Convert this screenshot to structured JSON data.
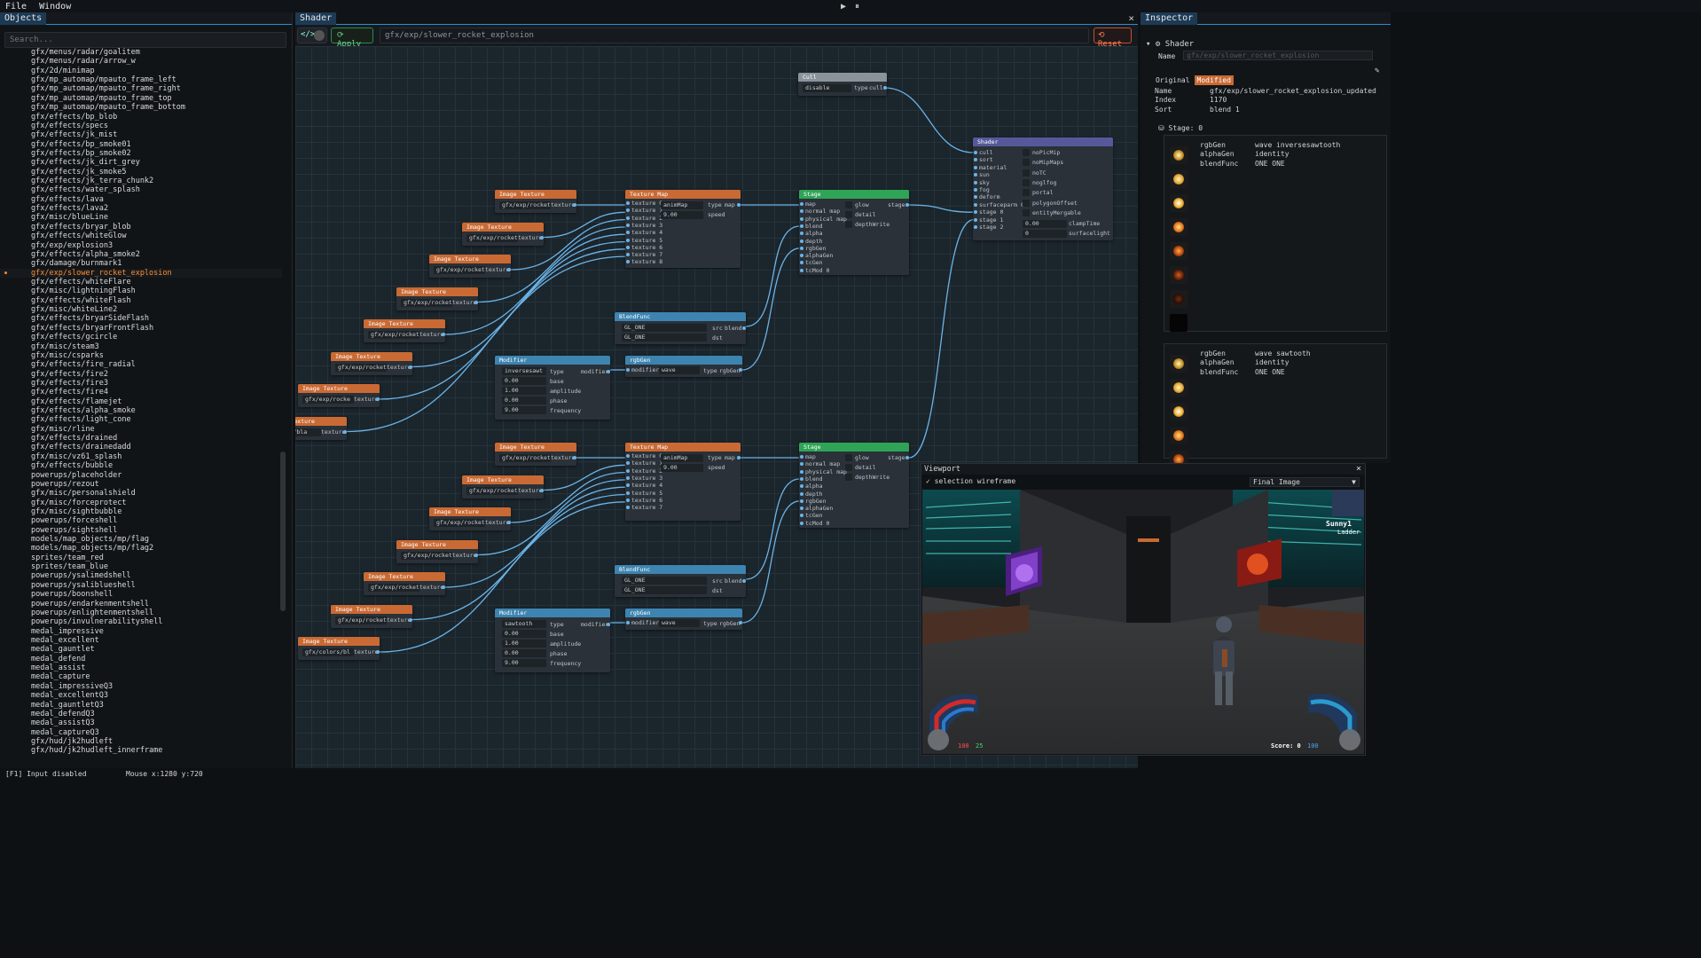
{
  "menu": {
    "file": "File",
    "window": "Window"
  },
  "playback": {
    "play": "▶",
    "pause": "⏸"
  },
  "objects": {
    "tab": "Objects",
    "search_placeholder": "Search...",
    "items": [
      "gfx/menus/radar/goalitem",
      "gfx/menus/radar/arrow_w",
      "gfx/2d/minimap",
      "gfx/mp_automap/mpauto_frame_left",
      "gfx/mp_automap/mpauto_frame_right",
      "gfx/mp_automap/mpauto_frame_top",
      "gfx/mp_automap/mpauto_frame_bottom",
      "gfx/effects/bp_blob",
      "gfx/effects/specs",
      "gfx/effects/jk_mist",
      "gfx/effects/bp_smoke01",
      "gfx/effects/bp_smoke02",
      "gfx/effects/jk_dirt_grey",
      "gfx/effects/jk_smoke5",
      "gfx/effects/jk_terra_chunk2",
      "gfx/effects/water_splash",
      "gfx/effects/lava",
      "gfx/effects/lava2",
      "gfx/misc/blueLine",
      "gfx/effects/bryar_blob",
      "gfx/effects/whiteGlow",
      "gfx/exp/explosion3",
      "gfx/effects/alpha_smoke2",
      "gfx/damage/burnmark1",
      "gfx/exp/slower_rocket_explosion",
      "gfx/effects/whiteFlare",
      "gfx/misc/lightningFlash",
      "gfx/effects/whiteFlash",
      "gfx/misc/whiteLine2",
      "gfx/effects/bryarSideFlash",
      "gfx/effects/bryarFrontFlash",
      "gfx/effects/gcircle",
      "gfx/misc/steam3",
      "gfx/misc/csparks",
      "gfx/effects/fire_radial",
      "gfx/effects/fire2",
      "gfx/effects/fire3",
      "gfx/effects/fire4",
      "gfx/effects/flamejet",
      "gfx/effects/alpha_smoke",
      "gfx/effects/light_cone",
      "gfx/misc/rline",
      "gfx/effects/drained",
      "gfx/effects/drainedadd",
      "gfx/misc/vz61_splash",
      "gfx/effects/bubble",
      "powerups/placeholder",
      "powerups/rezout",
      "gfx/misc/personalshield",
      "gfx/misc/forceprotect",
      "gfx/misc/sightbubble",
      "powerups/forceshell",
      "powerups/sightshell",
      "models/map_objects/mp/flag",
      "models/map_objects/mp/flag2",
      "sprites/team_red",
      "sprites/team_blue",
      "powerups/ysalimedshell",
      "powerups/ysaliblueshell",
      "powerups/boonshell",
      "powerups/endarkenmentshell",
      "powerups/enlightenmentshell",
      "powerups/invulnerabilityshell",
      "medal_impressive",
      "medal_excellent",
      "medal_gauntlet",
      "medal_defend",
      "medal_assist",
      "medal_capture",
      "medal_impressiveQ3",
      "medal_excellentQ3",
      "medal_gauntletQ3",
      "medal_defendQ3",
      "medal_assistQ3",
      "medal_captureQ3",
      "gfx/hud/jk2hudleft",
      "gfx/hud/jk2hudleft_innerframe"
    ],
    "selected_index": 24
  },
  "shader_panel": {
    "tab": "Shader",
    "close": "×",
    "toggle_label": "</>",
    "apply": "⟳ Apply",
    "path": "gfx/exp/slower_rocket_explosion",
    "reset": "⟲ Reset"
  },
  "graph": {
    "cull": {
      "title": "Cull",
      "value": "disable",
      "in": "type",
      "out": "cull"
    },
    "shader": {
      "title": "Shader",
      "inputs": [
        "cull",
        "sort",
        "material",
        "sun",
        "sky",
        "fog",
        "deform",
        "surfaceparm 0",
        "stage 0",
        "stage 1",
        "stage 2"
      ],
      "flags": [
        "noPicMip",
        "noMipMaps",
        "noTC",
        "noglfog",
        "portal",
        "polygonOffset",
        "entityMergable"
      ],
      "clamp_value": "0.00",
      "clamp_label": "clampTime",
      "surface_value": "0",
      "surface_label": "surfacelight"
    },
    "image_title": "Image Texture",
    "image_out": "texture",
    "images_a": [
      "gfx/exp/rocket",
      "gfx/exp/rocket",
      "gfx/exp/rocket",
      "gfx/exp/rocket",
      "gfx/exp/rocket",
      "gfx/exp/rocket",
      "gfx/exp/rocke",
      "colors/bla"
    ],
    "images_b": [
      "gfx/exp/rocket",
      "gfx/exp/rocket",
      "gfx/exp/rocket",
      "gfx/exp/rocket",
      "gfx/exp/rocket",
      "gfx/exp/rocket",
      "gfx/colors/bl"
    ],
    "texmap": {
      "title": "Texture Map",
      "mode": "animMap",
      "type_label": "type",
      "speed": "9.00",
      "speed_label": "speed",
      "out": "map"
    },
    "texmap_inputs_a": [
      "texture 0",
      "texture 1",
      "texture 2",
      "texture 3",
      "texture 4",
      "texture 5",
      "texture 6",
      "texture 7",
      "texture 8"
    ],
    "texmap_inputs_b": [
      "texture 0",
      "texture 1",
      "texture 2",
      "texture 3",
      "texture 4",
      "texture 5",
      "texture 6",
      "texture 7"
    ],
    "stage": {
      "title": "Stage",
      "inputs": [
        "map",
        "normal map",
        "physical map",
        "blend",
        "alpha",
        "depth",
        "rgbGen",
        "alphaGen",
        "tcGen",
        "tcMod 0"
      ],
      "flags": [
        "glow",
        "detail",
        "depthWrite"
      ],
      "out": "stage"
    },
    "blend": {
      "title": "BlendFunc",
      "src": "GL_ONE",
      "dst": "GL_ONE",
      "src_label": "src",
      "dst_label": "dst",
      "out": "blend"
    },
    "modifier_a": {
      "title": "Modifier",
      "type": "inversesawt",
      "fields": [
        [
          "type",
          ""
        ],
        [
          "base",
          "0.00"
        ],
        [
          "amplitude",
          "1.00"
        ],
        [
          "phase",
          "0.00"
        ],
        [
          "frequency",
          "9.00"
        ]
      ],
      "out": "modifier"
    },
    "modifier_b": {
      "title": "Modifier",
      "type": "sawtooth",
      "fields": [
        [
          "type",
          ""
        ],
        [
          "base",
          "0.00"
        ],
        [
          "amplitude",
          "1.00"
        ],
        [
          "phase",
          "0.00"
        ],
        [
          "frequency",
          "9.00"
        ]
      ],
      "out": "modifier"
    },
    "rgbgen": {
      "title": "rgbGen",
      "in": "modifier",
      "value": "wave",
      "type_label": "type",
      "out": "rgbGen"
    }
  },
  "inspector": {
    "tab": "Inspector",
    "section": "Shader",
    "name_label": "Name",
    "name_value": "gfx/exp/slower_rocket_explosion",
    "tabs": [
      "Original",
      "Modified"
    ],
    "props": [
      [
        "Name",
        "gfx/exp/slower_rocket_explosion_updated"
      ],
      [
        "Index",
        "1170"
      ],
      [
        "Sort",
        "blend 1"
      ]
    ],
    "stage_header": "Stage: 0",
    "stage0": [
      [
        "rgbGen",
        "wave inversesawtooth"
      ],
      [
        "alphaGen",
        "identity"
      ],
      [
        "blendFunc",
        "ONE ONE"
      ]
    ],
    "stage1": [
      [
        "rgbGen",
        "wave sawtooth"
      ],
      [
        "alphaGen",
        "identity"
      ],
      [
        "blendFunc",
        "ONE ONE"
      ]
    ]
  },
  "viewport": {
    "title": "Viewport",
    "close": "×",
    "wireframe": "✓ selection wireframe",
    "mode": "Final Image",
    "hud_player": "Sunny1",
    "hud_ladder": "Ladder",
    "hud_health": "100",
    "hud_armor": "25",
    "hud_ammo": "100",
    "hud_score": "Score: 0"
  },
  "status": {
    "input": "[F1] Input disabled",
    "mouse": "Mouse x:1280 y:720"
  },
  "colors": {
    "accent": "#ff8c2a",
    "orange_node": "#c96a34",
    "blue_node": "#3d84b0",
    "green_node": "#2fa457",
    "wire": "#6ab4e8"
  }
}
